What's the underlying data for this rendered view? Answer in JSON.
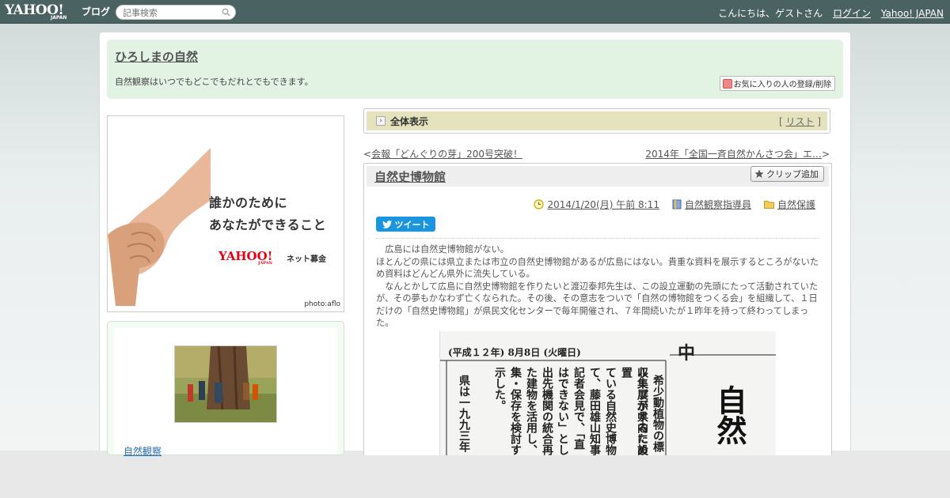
{
  "topbar": {
    "logo_yahoo": "YAHOO!",
    "logo_japan": "JAPAN",
    "logo_blog": "ブログ",
    "search_placeholder": "記事検索",
    "greeting": "こんにちは、ゲストさん",
    "login": "ログイン",
    "yahoo_japan": "Yahoo! JAPAN"
  },
  "header": {
    "title": "ひろしまの自然",
    "description": "自然観察はいつでもどこでもだれとでもできます。",
    "favorite_button": "お気に入りの人の登録/削除"
  },
  "ad": {
    "line1": "誰かのために",
    "line2": "あなたができること",
    "logo": "YAHOO!",
    "logo_japan": "JAPAN",
    "net": "ネット募金",
    "credit": "photo:aflo"
  },
  "profile": {
    "name": "自然観察"
  },
  "view_bar": {
    "title": "全体表示",
    "list_open": "[ ",
    "list_label": "リスト",
    "list_close": " ]"
  },
  "nav": {
    "prev_prefix": "<",
    "prev": "会報「どんぐりの芽」200号突破！",
    "next": "2014年「全国一斉自然かんさつ会」エ…",
    "next_suffix": ">"
  },
  "article": {
    "title": "自然史博物館",
    "clip_button": "クリップ追加",
    "date": "2014/1/20(月) 午前 8:11",
    "category1": "自然観察指導員",
    "category2": "自然保護",
    "tweet": "ツイート",
    "paragraphs": [
      "　広島には自然史博物館がない。",
      "ほとんどの県には県立または市立の自然史博物館があるが広島にはない。貴重な資料を展示するところがないため資料はどんどん県外に流失している。",
      "　なんとかして広島に自然史博物館を作りたいと渡辺泰邦先生は、この設立運動の先頭にたって活動されていたが、その夢もかなわず亡くなられた。その後、その意志をついで「自然の博物館をつくる会」を組織して、１日だけの「自然史博物館」が県民文化センターで毎年開催され、７年間続いたが１昨年を持って終わってしまった。"
    ],
    "newspaper": {
      "date": "(平成１２年) 8月8日  (火曜日)",
      "header_char": "中",
      "col1": "希少動植物の標",
      "col2": "収集展示するため",
      "col3": "ループが県内に設置",
      "col4": "ている自然史博物",
      "col5": "て、藤田雄山知事",
      "col6": "記者会見で、「直",
      "col7": "はできない」とし",
      "col8": "出先機関の統合再",
      "col9": "た建物を活用し、",
      "col10": "集・保存を検討す",
      "col11": "示した。",
      "col12": "県は一九九三年",
      "headline": "自然"
    }
  }
}
